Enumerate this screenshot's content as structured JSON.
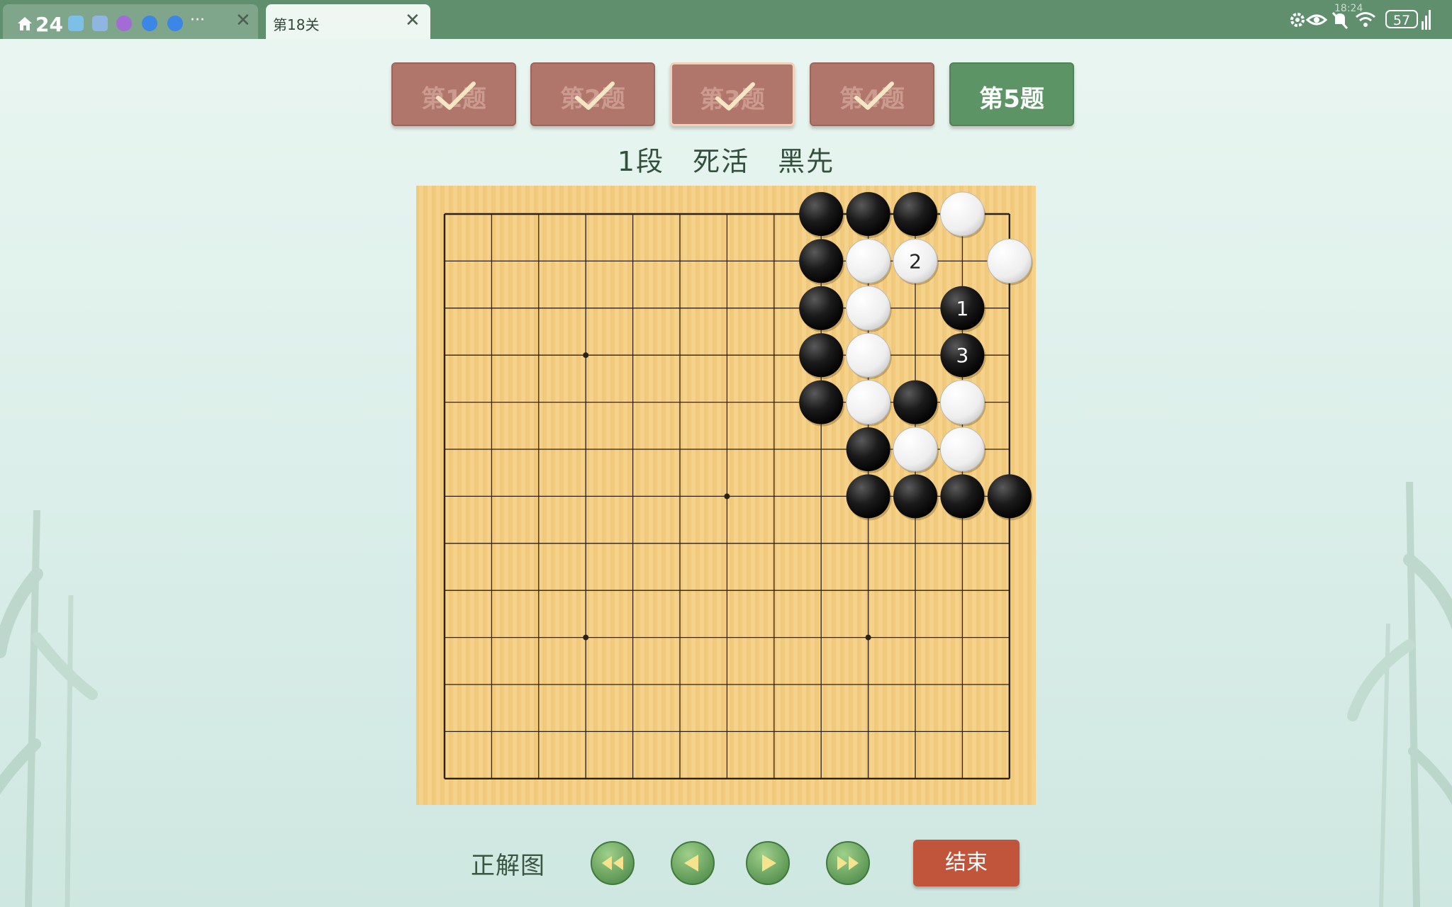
{
  "window": {
    "tabs": [
      {
        "label": "24",
        "kind": "app-launcher"
      },
      {
        "label": "第18关",
        "kind": "active"
      }
    ],
    "status": {
      "battery": "57",
      "time": "18:24"
    }
  },
  "problems": {
    "items": [
      {
        "label": "第1题",
        "state": "solved"
      },
      {
        "label": "第2题",
        "state": "solved"
      },
      {
        "label": "第3题",
        "state": "solved"
      },
      {
        "label": "第4题",
        "state": "solved"
      },
      {
        "label": "第5题",
        "state": "current"
      }
    ]
  },
  "problem_info": {
    "text": "1段　死活　黑先"
  },
  "board": {
    "size": 13,
    "star_points": [
      [
        3,
        3
      ],
      [
        3,
        9
      ],
      [
        6,
        6
      ],
      [
        9,
        3
      ],
      [
        9,
        9
      ]
    ],
    "stones": [
      {
        "col": 8,
        "row": 0,
        "color": "black"
      },
      {
        "col": 9,
        "row": 0,
        "color": "black"
      },
      {
        "col": 10,
        "row": 0,
        "color": "black"
      },
      {
        "col": 11,
        "row": 0,
        "color": "white"
      },
      {
        "col": 8,
        "row": 1,
        "color": "black"
      },
      {
        "col": 9,
        "row": 1,
        "color": "white"
      },
      {
        "col": 10,
        "row": 1,
        "color": "white",
        "label": "2"
      },
      {
        "col": 12,
        "row": 1,
        "color": "white"
      },
      {
        "col": 8,
        "row": 2,
        "color": "black"
      },
      {
        "col": 9,
        "row": 2,
        "color": "white"
      },
      {
        "col": 11,
        "row": 2,
        "color": "black",
        "label": "1"
      },
      {
        "col": 8,
        "row": 3,
        "color": "black"
      },
      {
        "col": 9,
        "row": 3,
        "color": "white"
      },
      {
        "col": 11,
        "row": 3,
        "color": "black",
        "label": "3"
      },
      {
        "col": 8,
        "row": 4,
        "color": "black"
      },
      {
        "col": 9,
        "row": 4,
        "color": "white"
      },
      {
        "col": 10,
        "row": 4,
        "color": "black"
      },
      {
        "col": 11,
        "row": 4,
        "color": "white"
      },
      {
        "col": 9,
        "row": 5,
        "color": "black"
      },
      {
        "col": 10,
        "row": 5,
        "color": "white"
      },
      {
        "col": 11,
        "row": 5,
        "color": "white"
      },
      {
        "col": 9,
        "row": 6,
        "color": "black"
      },
      {
        "col": 10,
        "row": 6,
        "color": "black"
      },
      {
        "col": 11,
        "row": 6,
        "color": "black"
      },
      {
        "col": 12,
        "row": 6,
        "color": "black"
      }
    ]
  },
  "controls": {
    "answer_label": "正解图",
    "nav": [
      "first-move-icon",
      "previous-move-icon",
      "next-move-icon",
      "last-move-icon"
    ],
    "end_label": "结束"
  },
  "colors": {
    "accent_green": "#5c9466",
    "solved_tab": "#b0766b",
    "end_button": "#c0553c",
    "board": "#f0c978"
  }
}
